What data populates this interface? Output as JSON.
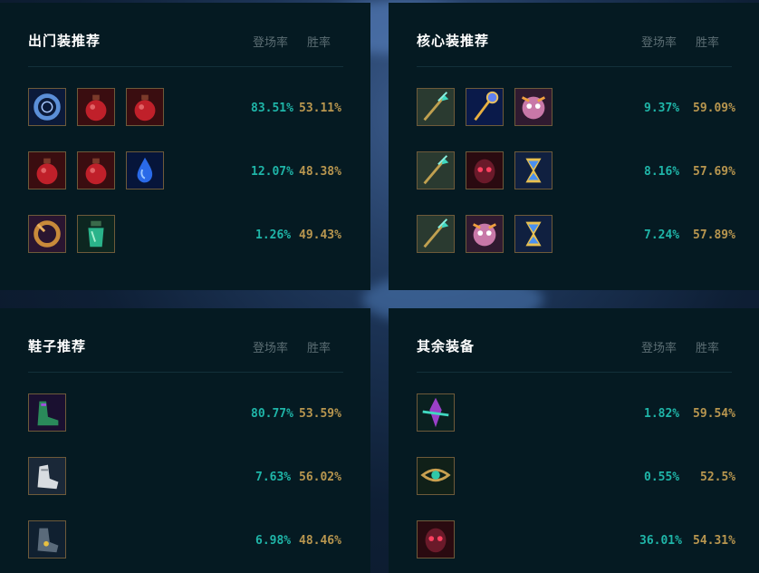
{
  "panels": [
    {
      "title": "出门装推荐",
      "col_pick": "登场率",
      "col_win": "胜率",
      "rows": [
        {
          "items": [
            "dark-seal-icon",
            "health-potion-icon",
            "health-potion-icon"
          ],
          "pick": "83.51%",
          "win": "53.11%"
        },
        {
          "items": [
            "health-potion-icon",
            "health-potion-icon",
            "tear-of-goddess-icon"
          ],
          "pick": "12.07%",
          "win": "48.38%"
        },
        {
          "items": [
            "cull-ring-icon",
            "refillable-potion-icon"
          ],
          "pick": "1.26%",
          "win": "49.43%"
        }
      ]
    },
    {
      "title": "核心装推荐",
      "col_pick": "登场率",
      "col_win": "胜率",
      "rows": [
        {
          "items": [
            "spear-item-icon",
            "golden-scepter-icon",
            "pink-helm-icon"
          ],
          "pick": "9.37%",
          "win": "59.09%"
        },
        {
          "items": [
            "spear-item-icon",
            "dark-mask-icon",
            "hourglass-icon"
          ],
          "pick": "8.16%",
          "win": "57.69%"
        },
        {
          "items": [
            "spear-item-icon",
            "pink-helm-icon",
            "hourglass-icon"
          ],
          "pick": "7.24%",
          "win": "57.89%"
        }
      ]
    },
    {
      "title": "鞋子推荐",
      "col_pick": "登场率",
      "col_win": "胜率",
      "rows": [
        {
          "items": [
            "green-boots-icon"
          ],
          "pick": "80.77%",
          "win": "53.59%"
        },
        {
          "items": [
            "white-boots-icon"
          ],
          "pick": "7.63%",
          "win": "56.02%"
        },
        {
          "items": [
            "steel-boots-icon"
          ],
          "pick": "6.98%",
          "win": "48.46%"
        }
      ]
    },
    {
      "title": "其余装备",
      "col_pick": "登场率",
      "col_win": "胜率",
      "rows": [
        {
          "items": [
            "void-crystal-icon"
          ],
          "pick": "1.82%",
          "win": "59.54%"
        },
        {
          "items": [
            "chain-belt-icon"
          ],
          "pick": "0.55%",
          "win": "52.5%"
        },
        {
          "items": [
            "dark-mask-icon"
          ],
          "pick": "36.01%",
          "win": "54.31%"
        }
      ]
    }
  ],
  "colors": {
    "panel_bg": "#051a22",
    "pick_rate": "#1fb5a8",
    "win_rate": "#b8964f",
    "column_header": "#5b6d73"
  }
}
